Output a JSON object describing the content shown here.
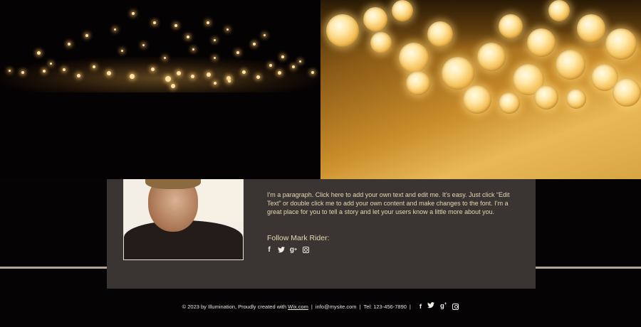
{
  "about": {
    "paragraph": "I'm a paragraph. Click here to add your own text and edit me. It’s easy. Just click “Edit Text” or double click me to add your own content and make changes to the font. I’m a great place for you to tell a story and let your users know a little more about you.",
    "follow_label": "Follow Mark Rider:",
    "social_icons": [
      "facebook-icon",
      "twitter-icon",
      "google-plus-icon",
      "instagram-icon"
    ]
  },
  "footer": {
    "copyright_prefix": "© 2023 by Illumination, Proudly created with",
    "wix_link": "Wix.com",
    "email": "info@mysite.com",
    "tel": "Tel: 123-456-7890",
    "social_icons": [
      "facebook-icon",
      "twitter-icon",
      "google-plus-icon",
      "instagram-icon"
    ]
  },
  "colors": {
    "background": "#060304",
    "panel": "#3a3533",
    "text": "#e8d7b0",
    "divider": "#b3a592"
  }
}
